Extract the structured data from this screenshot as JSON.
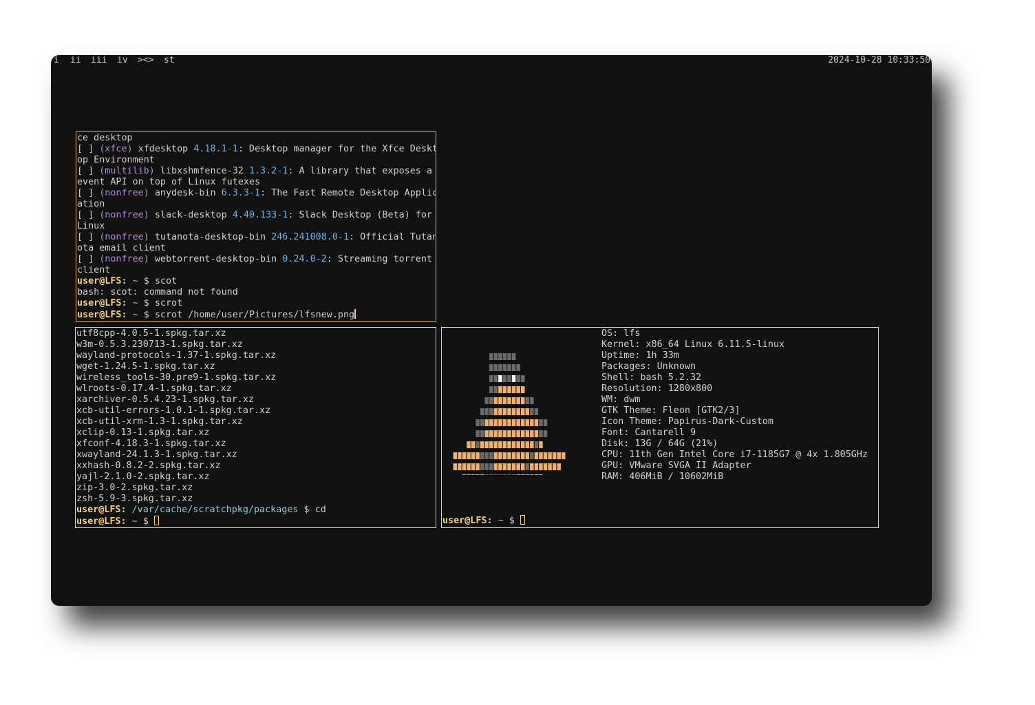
{
  "topbar": {
    "tags": [
      "i",
      "ii",
      "iii",
      "iv",
      "><>",
      "st"
    ],
    "datetime": "2024-10-28 10:33:50"
  },
  "search_terminal": {
    "lines": [
      {
        "text": "ce desktop"
      },
      {
        "check": "[ ] ",
        "repo": "(xfce)",
        "name": " xfdesktop ",
        "version": "4.18.1-1",
        "desc": ": Desktop manager for the Xfce Deskt"
      },
      {
        "text": "op Environment"
      },
      {
        "check": "[ ] ",
        "repo": "(multilib)",
        "name": " libxshmfence-32 ",
        "version": "1.3.2-1",
        "desc": ": A library that exposes a"
      },
      {
        "text": "event API on top of Linux futexes"
      },
      {
        "check": "[ ] ",
        "repo": "(nonfree)",
        "name": " anydesk-bin ",
        "version": "6.3.3-1",
        "desc": ": The Fast Remote Desktop Applic"
      },
      {
        "text": "ation"
      },
      {
        "check": "[ ] ",
        "repo": "(nonfree)",
        "name": " slack-desktop ",
        "version": "4.40.133-1",
        "desc": ": Slack Desktop (Beta) for"
      },
      {
        "text": "Linux"
      },
      {
        "check": "[ ] ",
        "repo": "(nonfree)",
        "name": " tutanota-desktop-bin ",
        "version": "246.241008.0-1",
        "desc": ": Official Tutan"
      },
      {
        "text": "ota email client"
      },
      {
        "check": "[ ] ",
        "repo": "(nonfree)",
        "name": " webtorrent-desktop-bin ",
        "version": "0.24.0-2",
        "desc": ": Streaming torrent"
      },
      {
        "text": "client"
      },
      {
        "prompt": "user@LFS:",
        "path": " ~",
        "cmd": " $ scot"
      },
      {
        "text": "bash: scot: command not found"
      },
      {
        "prompt": "user@LFS:",
        "path": " ~",
        "cmd": " $ scrot"
      },
      {
        "prompt": "user@LFS:",
        "path": " ~",
        "cmd": " $ scrot /home/user/Pictures/lfsnew.png",
        "cursor": "bar"
      }
    ]
  },
  "packages_terminal": {
    "files": [
      "utf8cpp-4.0.5-1.spkg.tar.xz",
      "w3m-0.5.3.230713-1.spkg.tar.xz",
      "wayland-protocols-1.37-1.spkg.tar.xz",
      "wget-1.24.5-1.spkg.tar.xz",
      "wireless_tools-30.pre9-1.spkg.tar.xz",
      "wlroots-0.17.4-1.spkg.tar.xz",
      "xarchiver-0.5.4.23-1.spkg.tar.xz",
      "xcb-util-errors-1.0.1-1.spkg.tar.xz",
      "xcb-util-xrm-1.3-1.spkg.tar.xz",
      "xclip-0.13-1.spkg.tar.xz",
      "xfconf-4.18.3-1.spkg.tar.xz",
      "xwayland-24.1.3-1.spkg.tar.xz",
      "xxhash-0.8.2-2.spkg.tar.xz",
      "yajl-2.1.0-2.spkg.tar.xz",
      "zip-3.0-2.spkg.tar.xz",
      "zsh-5.9-3.spkg.tar.xz"
    ],
    "prompt1": {
      "user": "user@LFS:",
      "path": " /var/cache/scratchpkg/packages",
      "cmd": " $ cd"
    },
    "prompt2": {
      "user": "user@LFS:",
      "path": " ~",
      "cmd": " $ "
    }
  },
  "fetch_terminal": {
    "info": [
      "OS: lfs",
      "Kernel: x86_64 Linux 6.11.5-linux",
      "Uptime: 1h 33m",
      "Packages: Unknown",
      "Shell: bash 5.2.32",
      "Resolution: 1280x800",
      "WM: dwm",
      "GTK Theme: Fleon [GTK2/3]",
      "Icon Theme: Papirus-Dark-Custom",
      "Font: Cantarell 9",
      "Disk: 13G / 64G (21%)",
      "CPU: 11th Gen Intel Core i7-1185G7 @ 4x 1.805GHz",
      "GPU: VMware SVGA II Adapter",
      "RAM: 406MiB / 10602MiB"
    ],
    "prompt": {
      "user": "user@LFS:",
      "path": " ~",
      "cmd": " $ "
    },
    "logo_icon": "tux-ascii-logo-icon",
    "colors": {
      "accent": "#f5cf7c",
      "logo_gray": "#6a6a6a",
      "logo_orange": "#f2b06a"
    }
  }
}
